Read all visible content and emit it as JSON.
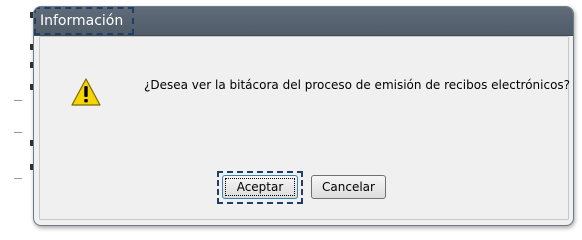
{
  "dialog": {
    "title": "Información",
    "message": "¿Desea ver la bitácora del proceso de emisión de recibos electrónicos?",
    "icon": "warning-icon",
    "buttons": {
      "accept_label": "Aceptar",
      "cancel_label": "Cancelar"
    }
  },
  "colors": {
    "titlebar": "#59656f",
    "dialog_bg": "#f0f0f0",
    "focus_outline": "#1f3f6a",
    "warning_yellow": "#f5d400"
  }
}
